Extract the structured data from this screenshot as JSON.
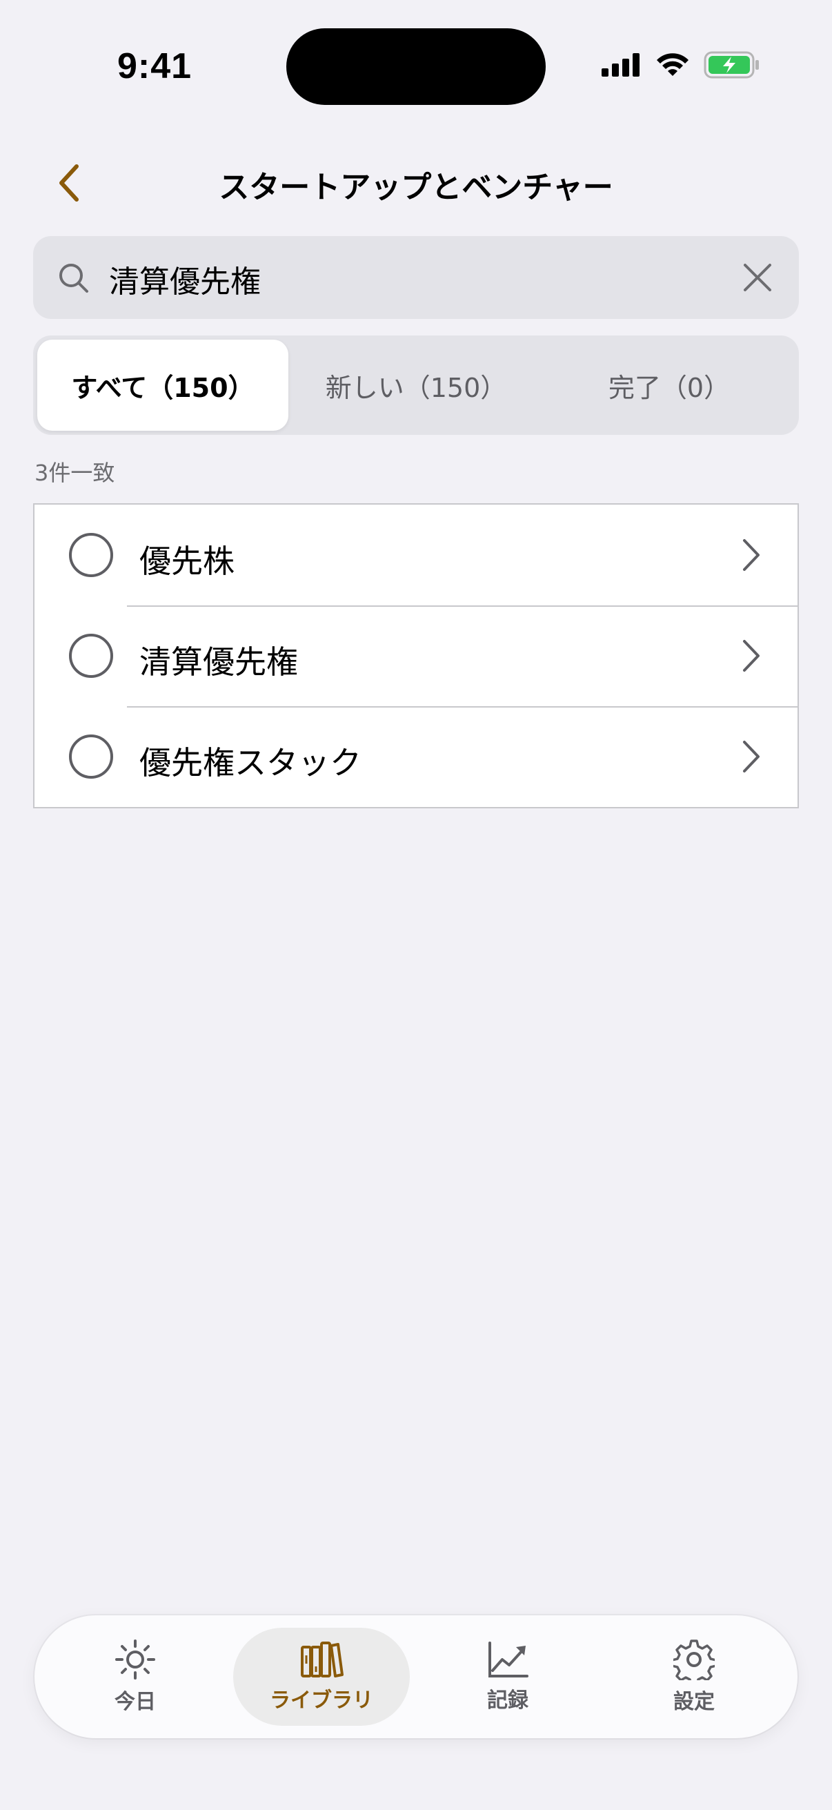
{
  "status": {
    "time": "9:41"
  },
  "nav": {
    "title": "スタートアップとベンチャー"
  },
  "search": {
    "value": "清算優先権"
  },
  "filters": [
    {
      "label": "すべて（150）",
      "active": true
    },
    {
      "label": "新しい（150）",
      "active": false
    },
    {
      "label": "完了（0）",
      "active": false
    }
  ],
  "result_count": "3件一致",
  "items": [
    {
      "label": "優先株"
    },
    {
      "label": "清算優先権"
    },
    {
      "label": "優先権スタック"
    }
  ],
  "tabbar": {
    "today": "今日",
    "library": "ライブラリ",
    "records": "記録",
    "settings": "設定"
  },
  "colors": {
    "accent": "#8a5a0a",
    "background": "#f2f1f6",
    "battery": "#34c759"
  }
}
